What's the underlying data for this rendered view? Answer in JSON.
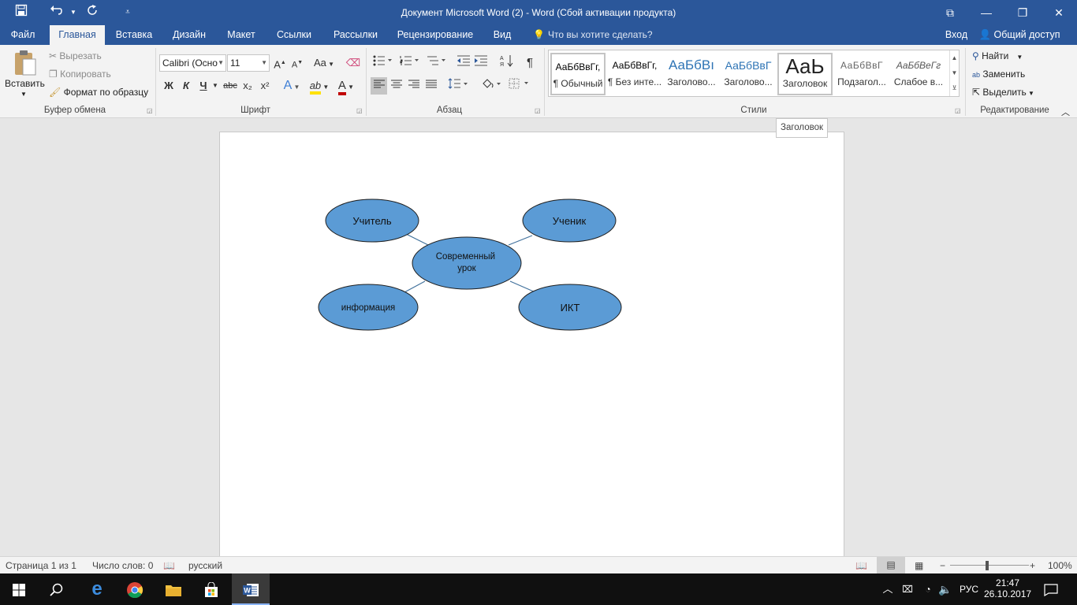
{
  "window": {
    "title": "Документ Microsoft Word (2) - Word (Сбой активации продукта)",
    "buttons": {
      "ribbon_display": "⧉",
      "minimize": "—",
      "restore": "❐",
      "close": "✕"
    }
  },
  "quick_access": {
    "save_icon": "save-icon",
    "undo_icon": "undo-icon",
    "redo_icon": "redo-icon",
    "customize_icon": "customize-icon"
  },
  "tabs": [
    "Файл",
    "Главная",
    "Вставка",
    "Дизайн",
    "Макет",
    "Ссылки",
    "Рассылки",
    "Рецензирование",
    "Вид"
  ],
  "active_tab": "Главная",
  "tell_me": "Что вы хотите сделать?",
  "account": {
    "login": "Вход",
    "share": "Общий доступ"
  },
  "clipboard": {
    "paste": "Вставить",
    "cut": "Вырезать",
    "copy": "Копировать",
    "format_painter": "Формат по образцу",
    "group": "Буфер обмена"
  },
  "font": {
    "name": "Calibri (Осно",
    "size": "11",
    "grow": "A",
    "shrink": "A",
    "change_case": "Aa",
    "bold": "Ж",
    "italic": "К",
    "underline": "Ч",
    "strikethrough": "abc",
    "subscript": "x₂",
    "superscript": "x²",
    "text_effects": "A",
    "highlight": "ab",
    "font_color": "A",
    "group": "Шрифт"
  },
  "paragraph": {
    "group": "Абзац",
    "pilcrow": "¶"
  },
  "styles": {
    "group": "Стили",
    "items": [
      {
        "preview": "АаБбВвГг,",
        "name": "¶ Обычный"
      },
      {
        "preview": "АаБбВвГг,",
        "name": "¶ Без инте..."
      },
      {
        "preview": "АаБбВı",
        "name": "Заголово..."
      },
      {
        "preview": "АаБбВвГ",
        "name": "Заголово..."
      },
      {
        "preview": "АаЬ",
        "name": "Заголовок"
      },
      {
        "preview": "АаБбВвГ",
        "name": "Подзагол..."
      },
      {
        "preview": "АаБбВеГг",
        "name": "Слабое в..."
      }
    ]
  },
  "editing": {
    "find": "Найти",
    "replace": "Заменить",
    "select": "Выделить",
    "group": "Редактирование"
  },
  "tooltip": "Заголовок",
  "diagram": {
    "center": "Современный\nурок",
    "nodes": [
      "Учитель",
      "Ученик",
      "информация",
      "ИКТ"
    ],
    "fill": "#5b9bd5",
    "line": "#41719c"
  },
  "status": {
    "page": "Страница 1 из 1",
    "words": "Число слов: 0",
    "language": "русский",
    "zoom": "100%"
  },
  "taskbar": {
    "lang": "РУС",
    "time": "21:47",
    "date": "26.10.2017"
  }
}
